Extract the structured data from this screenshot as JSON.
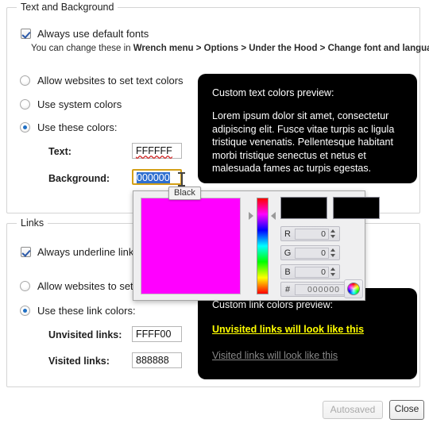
{
  "sections": {
    "text_and_background": {
      "legend": "Text and Background",
      "default_fonts_checkbox": {
        "label": "Always use default fonts",
        "checked": true
      },
      "hint": {
        "prefix": "You can change these in ",
        "bold": "Wrench menu > Options > Under the Hood > Change font and language settings"
      },
      "radios": [
        {
          "label": "Allow websites to set text colors",
          "selected": false
        },
        {
          "label": "Use system colors",
          "selected": false
        },
        {
          "label": "Use these colors:",
          "selected": true
        }
      ],
      "fields": [
        {
          "label": "Text:",
          "value": "FFFFFF",
          "focused": false
        },
        {
          "label": "Background:",
          "value": "000000",
          "focused": true,
          "selected": true
        }
      ],
      "preview": {
        "title": "Custom text colors preview:",
        "body": "Lorem ipsum dolor sit amet, consectetur adipiscing elit. Fusce vitae turpis ac ligula tristique venenatis. Pellentesque habitant morbi tristique senectus et netus et malesuada fames ac turpis egestas.",
        "background_color": "#000000",
        "text_color": "#FFFFFF"
      }
    },
    "links": {
      "legend": "Links",
      "underline_checkbox": {
        "label": "Always underline links",
        "checked": true
      },
      "radios": [
        {
          "label": "Allow websites to set link colors",
          "selected": false
        },
        {
          "label": "Use these link colors:",
          "selected": true
        }
      ],
      "fields": [
        {
          "label": "Unvisited links:",
          "value": "FFFF00"
        },
        {
          "label": "Visited links:",
          "value": "888888"
        }
      ],
      "preview": {
        "title": "Custom link colors preview:",
        "unvisited": "Unvisited links will look like this",
        "visited": "Visited links will look like this",
        "background_color": "#000000",
        "unvisited_color": "#FFFF00",
        "visited_color": "#888888"
      }
    }
  },
  "color_picker": {
    "tooltip": "Black",
    "sv_color": "#FF00FF",
    "new_swatch": "#000000",
    "current_swatch": "#000000",
    "channels": [
      {
        "name": "R",
        "value": "0"
      },
      {
        "name": "G",
        "value": "0"
      },
      {
        "name": "B",
        "value": "0"
      }
    ],
    "hex_label": "#",
    "hex_value": "000000"
  },
  "footer": {
    "autosaved_label": "Autosaved",
    "close_label": "Close"
  }
}
